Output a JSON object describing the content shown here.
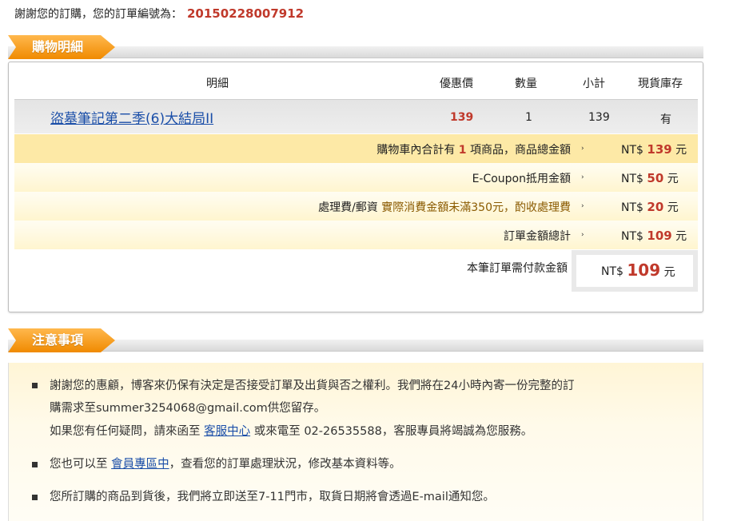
{
  "thanks": {
    "text": "謝謝您的訂購，您的訂單編號為：",
    "order_number": "20150228007912"
  },
  "details_section": {
    "title": "購物明細",
    "headers": {
      "item": "明細",
      "price": "優惠價",
      "qty": "數量",
      "subtotal": "小計",
      "stock": "現貨庫存"
    },
    "product": {
      "name": "盜墓筆記第二季(6)大結局II",
      "price": "139",
      "qty": "1",
      "subtotal": "139",
      "stock": "有"
    },
    "summary": {
      "cart_prefix": "購物車內合計有",
      "cart_count": "1",
      "cart_suffix": "項商品，商品總金額",
      "cart_amount": "139",
      "coupon_label": "E-Coupon抵用金額",
      "coupon_amount": "50",
      "shipping_label": "處理費/郵資",
      "shipping_note": "實際消費金額未滿350元，酌收處理費",
      "shipping_amount": "20",
      "total_label": "訂單金額總計",
      "total_amount": "109",
      "payable_label": "本筆訂單需付款金額",
      "payable_amount": "109",
      "currency": "NT$",
      "unit": "元",
      "arrow": "›"
    }
  },
  "notes_section": {
    "title": "注意事項",
    "note1_line1": "謝謝您的惠顧，博客來仍保有決定是否接受訂單及出貨與否之權利。我們將在24小時內寄一份完整的訂",
    "note1_line2": "購需求至summer3254068@gmail.com供您留存。",
    "note1_line3_prefix": "如果您有任何疑問，請來函至",
    "note1_line3_link": "客服中心",
    "note1_line3_suffix": "或來電至 02-26535588，客服專員將竭誠為您服務。",
    "note2_prefix": "您也可以至",
    "note2_link": "會員專區中",
    "note2_suffix": "，查看您的訂單處理狀況，修改基本資料等。",
    "note3": "您所訂購的商品到貨後，我們將立即送至7-11門市，取貨日期將會透過E-mail通知您。"
  }
}
